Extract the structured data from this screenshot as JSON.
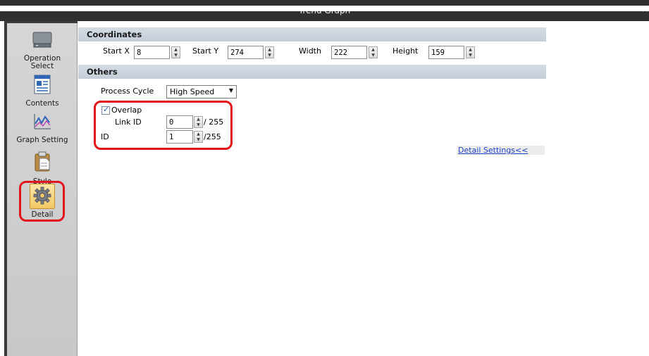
{
  "window": {
    "title": "Trend Graph",
    "close": "×"
  },
  "sidebar": {
    "items": [
      {
        "label_lines": [
          "Operation",
          "Select"
        ],
        "icon": "monitor-icon"
      },
      {
        "label_lines": [
          "Contents"
        ],
        "icon": "contents-icon"
      },
      {
        "label_lines": [
          "Graph Setting"
        ],
        "icon": "graph-icon"
      },
      {
        "label_lines": [
          "Style"
        ],
        "icon": "clipboard-icon"
      },
      {
        "label_lines": [
          "Detail"
        ],
        "icon": "gear-icon",
        "selected": true
      }
    ]
  },
  "coordinates": {
    "header": "Coordinates",
    "start_x": {
      "label": "Start X",
      "value": "8"
    },
    "start_y": {
      "label": "Start Y",
      "value": "274"
    },
    "width": {
      "label": "Width",
      "value": "222"
    },
    "height": {
      "label": "Height",
      "value": "159"
    }
  },
  "others": {
    "header": "Others",
    "process_cycle": {
      "label": "Process Cycle",
      "value": "High Speed"
    },
    "overlap": {
      "label": "Overlap",
      "checked": true
    },
    "link_id": {
      "label": "Link ID",
      "value": "0",
      "max": "/ 255"
    },
    "id": {
      "label": "ID",
      "value": "1",
      "max": "/255"
    }
  },
  "detail_settings_link": "Detail Settings<<",
  "colors": {
    "highlight": "#e3141c",
    "section_bar": "#c9d2dc",
    "link": "#1f44c9",
    "selected_item": "#f3c865"
  }
}
